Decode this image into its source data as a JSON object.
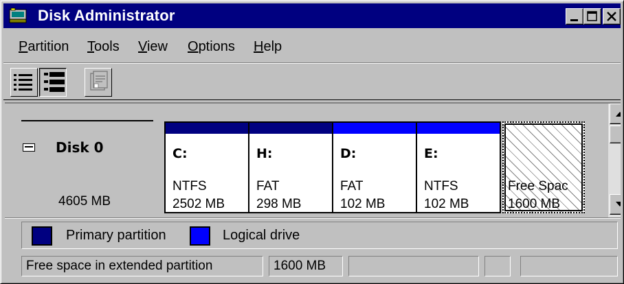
{
  "window": {
    "title": "Disk Administrator",
    "colors": {
      "titlebar": "#000080",
      "primary_partition": "#000080",
      "logical_drive": "#0000ff"
    }
  },
  "title_buttons": [
    "minimize",
    "maximize",
    "close"
  ],
  "menu": [
    {
      "label": "Partition",
      "mnemonic": "P"
    },
    {
      "label": "Tools",
      "mnemonic": "T"
    },
    {
      "label": "View",
      "mnemonic": "V"
    },
    {
      "label": "Options",
      "mnemonic": "O"
    },
    {
      "label": "Help",
      "mnemonic": "H"
    }
  ],
  "toolbar": [
    {
      "icon": "list-view-icon",
      "state": "raised"
    },
    {
      "icon": "detail-view-icon",
      "state": "pressed"
    },
    {
      "icon": "properties-icon",
      "state": "disabled"
    }
  ],
  "disk": {
    "name": "Disk 0",
    "size": "4605 MB",
    "partitions": [
      {
        "letter": "C:",
        "filesystem": "NTFS",
        "size": "2502 MB",
        "type": "primary",
        "selected": true
      },
      {
        "letter": "H:",
        "filesystem": "FAT",
        "size": "298 MB",
        "type": "primary",
        "selected": false
      },
      {
        "letter": "D:",
        "filesystem": "FAT",
        "size": "102 MB",
        "type": "logical",
        "selected": false
      },
      {
        "letter": "E:",
        "filesystem": "NTFS",
        "size": "102 MB",
        "type": "logical",
        "selected": false
      }
    ],
    "free_space": {
      "label": "Free Spac",
      "size": "1600 MB",
      "focused": true
    }
  },
  "legend": {
    "primary_label": "Primary partition",
    "logical_label": "Logical drive"
  },
  "status": {
    "description": "Free space in extended partition",
    "size": "1600 MB",
    "cell3": "",
    "cell4": "",
    "cell5": ""
  }
}
